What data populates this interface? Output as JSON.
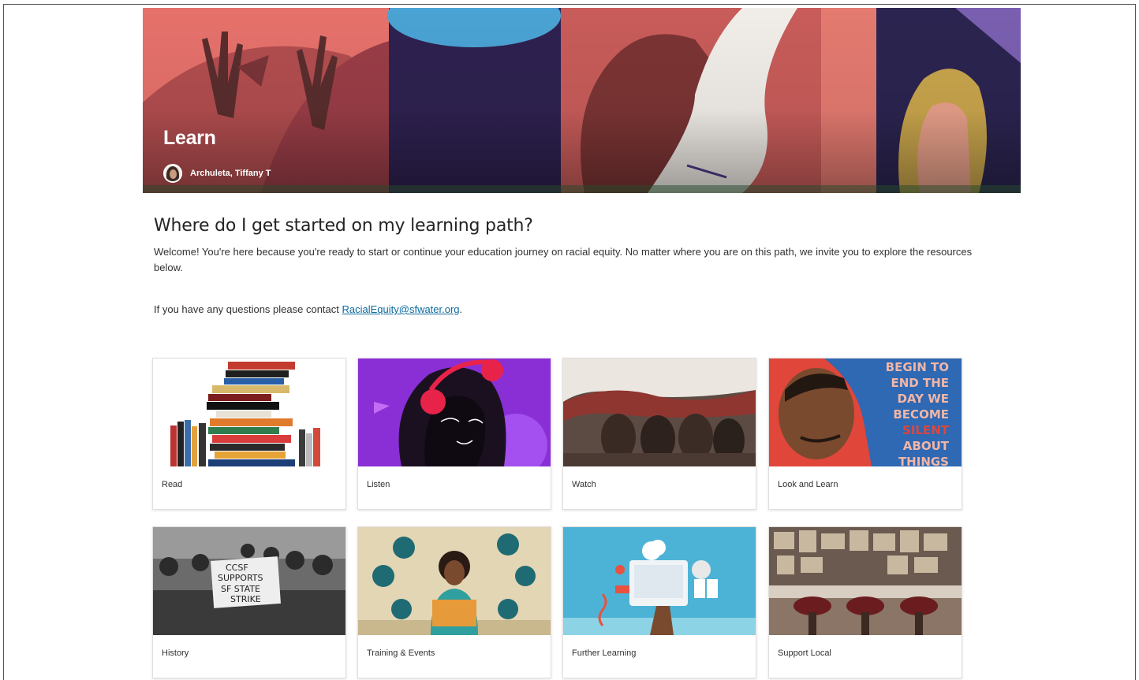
{
  "hero": {
    "title": "Learn",
    "author": "Archuleta, Tiffany T"
  },
  "main": {
    "heading": "Where do I get started on my learning path?",
    "intro": "Welcome! You're here because you're ready to start or continue your education journey on racial equity. No matter where you are on this path, we invite you to explore the resources below.",
    "contact_prefix": "If you have any questions please contact ",
    "contact_email": "RacialEquity@sfwater.org",
    "contact_suffix": "."
  },
  "cards": [
    {
      "label": "Read",
      "image": "stack-of-books-image"
    },
    {
      "label": "Listen",
      "image": "woman-with-headphones-illustration"
    },
    {
      "label": "Watch",
      "image": "film-still-image"
    },
    {
      "label": "Look and Learn",
      "image": "mlk-poster-illustration"
    },
    {
      "label": "History",
      "image": "protest-photo"
    },
    {
      "label": "Training & Events",
      "image": "training-illustration"
    },
    {
      "label": "Further Learning",
      "image": "online-learning-illustration"
    },
    {
      "label": "Support Local",
      "image": "restaurant-interior-photo"
    }
  ],
  "card_art_text": {
    "poster": [
      "BEGIN TO",
      "END THE",
      "DAY WE",
      "BECOME",
      "SILENT",
      "ABOUT",
      "THINGS"
    ],
    "protest_sign": [
      "CCSF",
      "SUPPORTS",
      "SF STATE",
      "STRIKE"
    ]
  }
}
